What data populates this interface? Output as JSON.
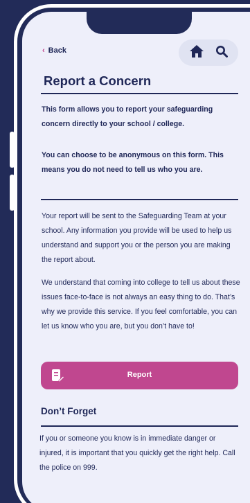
{
  "header": {
    "back_label": "Back",
    "icons": [
      "home-icon",
      "search-icon"
    ]
  },
  "page": {
    "title": "Report a Concern",
    "intro_1": "This form allows you to report your safeguarding concern directly to your school / college.",
    "intro_2": "You can choose to be anonymous on this form. This means you do not need to tell us who you are.",
    "body_1": "Your report will be sent to the Safeguarding Team at your school. Any information you provide will be used to help us understand and support you or the person you are making the report about.",
    "body_2": "We understand that coming into college to tell us about these issues face-to-face is not always an easy thing to do. That’s why we provide this service. If you feel comfortable, you can let us know who you are, but you don’t have to!",
    "report_button": "Report",
    "dont_forget_heading": "Don’t Forget",
    "dont_forget_text": "If you or someone you know is in immediate danger or injured, it is important that you quickly get the right help. Call the police on 999."
  },
  "colors": {
    "background": "#222b58",
    "screen": "#eeeffa",
    "text": "#1f2757",
    "accent": "#c0478f"
  }
}
